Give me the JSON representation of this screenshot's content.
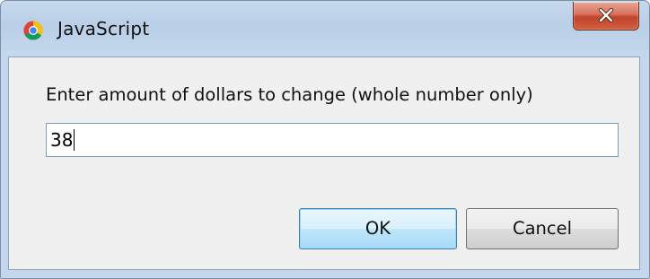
{
  "window": {
    "title": "JavaScript",
    "app_icon": "chrome-icon",
    "close_icon": "close-icon"
  },
  "prompt": {
    "message": "Enter amount of dollars to change (whole number only)",
    "input_value": "38"
  },
  "buttons": {
    "ok_label": "OK",
    "cancel_label": "Cancel"
  },
  "colors": {
    "titlebar": "#b9cfe7",
    "content_background": "#f0f0f0",
    "close_button": "#c0442b",
    "default_button_border": "#3c7fb1"
  }
}
